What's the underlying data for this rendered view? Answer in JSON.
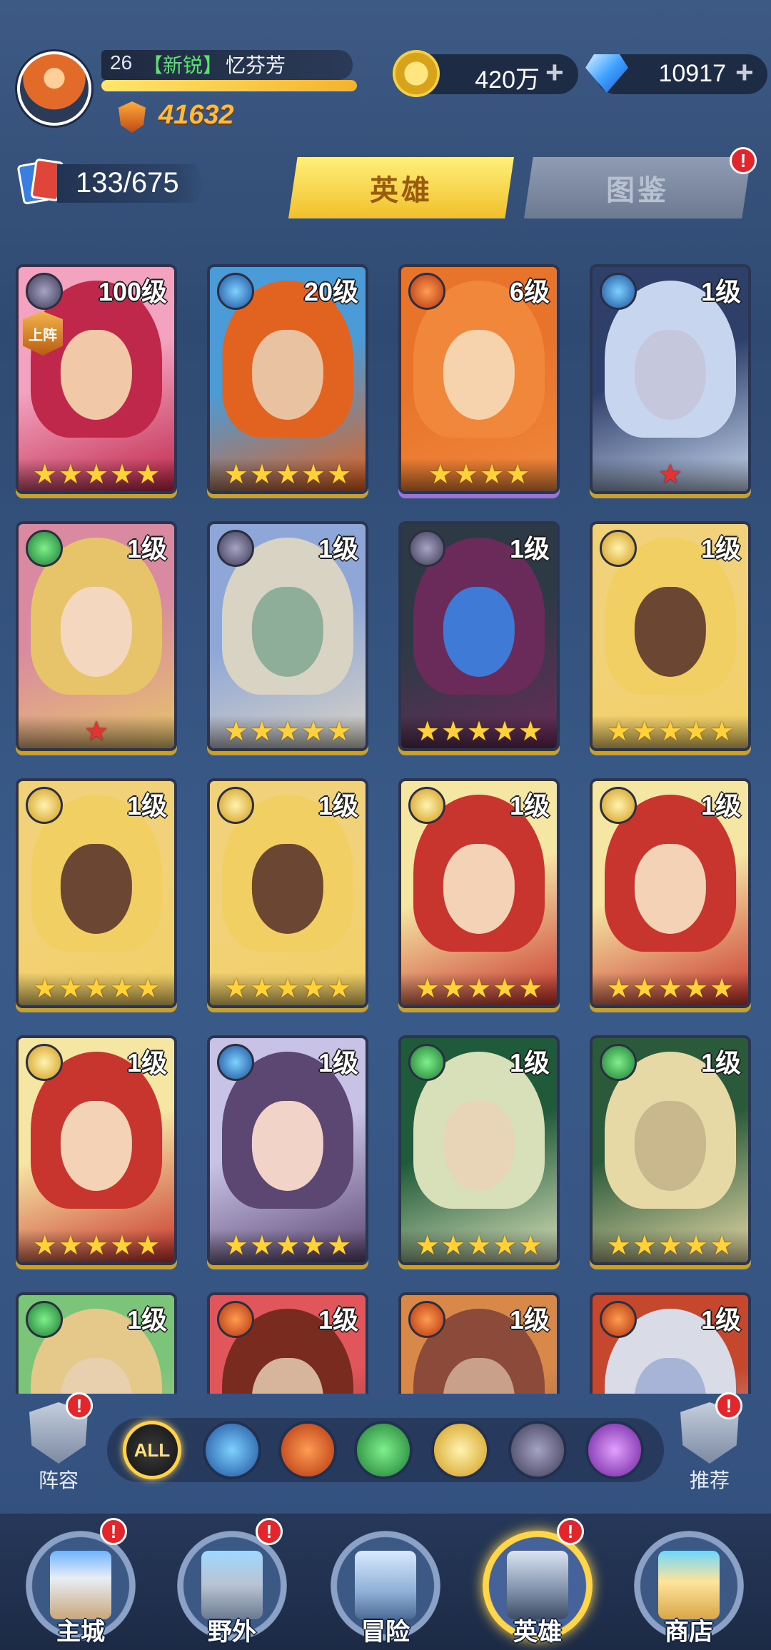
{
  "player": {
    "level": "26",
    "title_tag": "【新锐】",
    "name": "忆芬芳",
    "power": "41632",
    "xp_progress": 1.0
  },
  "resources": {
    "gold": "420万",
    "gems": "10917",
    "plus": "+"
  },
  "collection": {
    "count": "133/675"
  },
  "tabs": [
    {
      "label": "英雄",
      "active": true
    },
    {
      "label": "图鉴",
      "active": false,
      "badge": "!"
    }
  ],
  "heroes": [
    {
      "level": "100级",
      "faction": "dark",
      "stars": 5,
      "star_color": "gold",
      "deployed": "上阵"
    },
    {
      "level": "20级",
      "faction": "water",
      "stars": 5,
      "star_color": "gold"
    },
    {
      "level": "6级",
      "faction": "fire",
      "stars": 4,
      "star_color": "gold"
    },
    {
      "level": "1级",
      "faction": "water",
      "stars": 1,
      "star_color": "red"
    },
    {
      "level": "1级",
      "faction": "nature",
      "stars": 1,
      "star_color": "red"
    },
    {
      "level": "1级",
      "faction": "dark",
      "stars": 5,
      "star_color": "gold"
    },
    {
      "level": "1级",
      "faction": "dark",
      "stars": 5,
      "star_color": "gold"
    },
    {
      "level": "1级",
      "faction": "light",
      "stars": 5,
      "star_color": "gold"
    },
    {
      "level": "1级",
      "faction": "light",
      "stars": 5,
      "star_color": "gold"
    },
    {
      "level": "1级",
      "faction": "light",
      "stars": 5,
      "star_color": "gold"
    },
    {
      "level": "1级",
      "faction": "light",
      "stars": 5,
      "star_color": "gold"
    },
    {
      "level": "1级",
      "faction": "light",
      "stars": 5,
      "star_color": "gold"
    },
    {
      "level": "1级",
      "faction": "light",
      "stars": 5,
      "star_color": "gold"
    },
    {
      "level": "1级",
      "faction": "water",
      "stars": 5,
      "star_color": "gold"
    },
    {
      "level": "1级",
      "faction": "nature",
      "stars": 5,
      "star_color": "gold"
    },
    {
      "level": "1级",
      "faction": "nature",
      "stars": 5,
      "star_color": "gold"
    },
    {
      "level": "1级",
      "faction": "nature",
      "stars": 0,
      "star_color": "gold"
    },
    {
      "level": "1级",
      "faction": "fire",
      "stars": 0,
      "star_color": "gold"
    },
    {
      "level": "1级",
      "faction": "fire",
      "stars": 0,
      "star_color": "gold"
    },
    {
      "level": "1级",
      "faction": "fire",
      "stars": 0,
      "star_color": "gold"
    }
  ],
  "filters": {
    "lineup_label": "阵容",
    "recommend_label": "推荐",
    "all_label": "ALL",
    "badge": "!",
    "factions": [
      "water",
      "fire",
      "nature",
      "light",
      "dark",
      "arcane"
    ]
  },
  "nav": [
    {
      "label": "主城",
      "badge": "!",
      "active": false
    },
    {
      "label": "野外",
      "badge": "!",
      "active": false
    },
    {
      "label": "冒险",
      "badge": "",
      "active": false
    },
    {
      "label": "英雄",
      "badge": "!",
      "active": true
    },
    {
      "label": "商店",
      "badge": "",
      "active": false
    }
  ],
  "colors": {
    "gold_star": "#ffd23a",
    "red_star": "#e53232",
    "power": "#ffb93c",
    "tab_active": "#f1c02c",
    "title_tag": "#58e56c"
  }
}
